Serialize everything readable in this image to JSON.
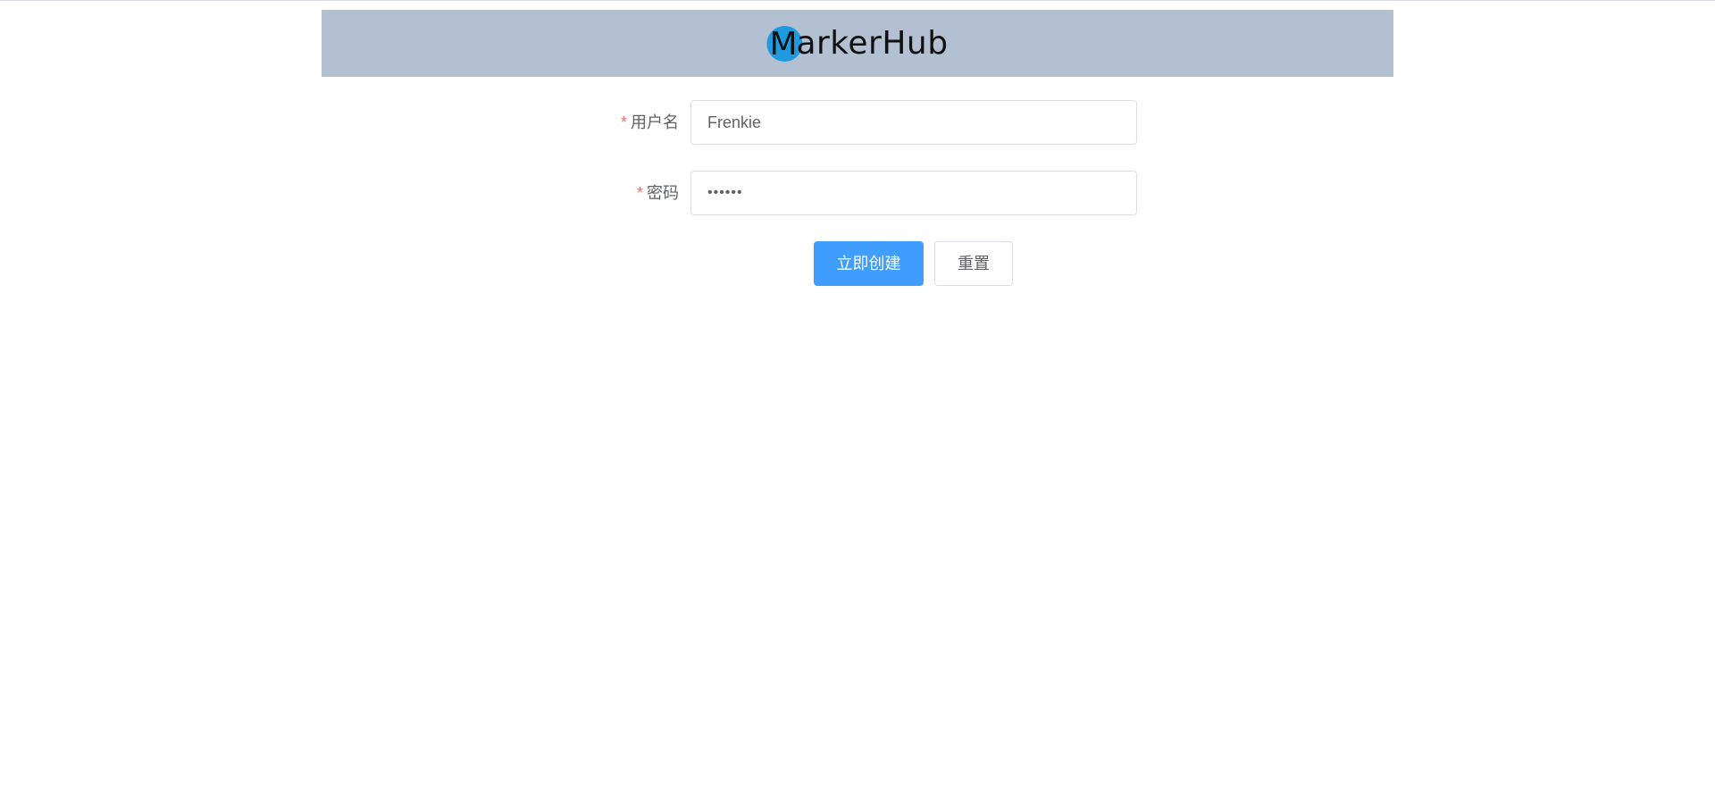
{
  "header": {
    "logo_text_first": "M",
    "logo_text_rest": "arkerHub",
    "background_color": "#b3c0d1",
    "logo_circle_color": "#1e9be0"
  },
  "form": {
    "username": {
      "required_mark": "*",
      "label": "用户名",
      "value": "Frenkie"
    },
    "password": {
      "required_mark": "*",
      "label": "密码",
      "value": "••••••"
    }
  },
  "buttons": {
    "submit_label": "立即创建",
    "reset_label": "重置",
    "primary_color": "#409eff"
  }
}
